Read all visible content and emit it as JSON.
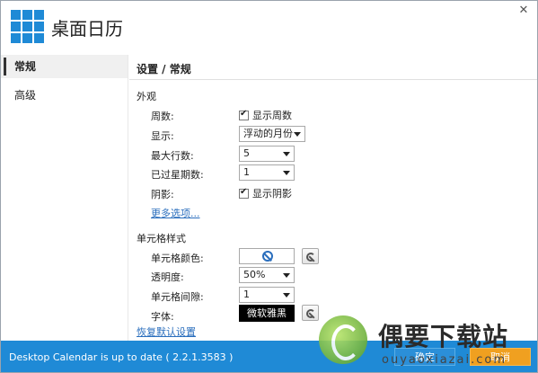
{
  "app": {
    "title": "桌面日历"
  },
  "sidebar": {
    "items": [
      {
        "label": "常规",
        "active": true
      },
      {
        "label": "高级",
        "active": false
      }
    ]
  },
  "content": {
    "title": "设置 / 常规",
    "appearance": {
      "section_label": "外观",
      "week_number": {
        "label": "周数:",
        "checkbox_label": "显示周数",
        "checked": true
      },
      "display": {
        "label": "显示:",
        "value": "浮动的月份"
      },
      "max_rows": {
        "label": "最大行数:",
        "value": "5"
      },
      "past_weeks": {
        "label": "已过星期数:",
        "value": "1"
      },
      "shadow": {
        "label": "阴影:",
        "checkbox_label": "显示阴影",
        "checked": true
      },
      "more_options": "更多选项..."
    },
    "cell_style": {
      "section_label": "单元格样式",
      "cell_color": {
        "label": "单元格颜色:"
      },
      "opacity": {
        "label": "透明度:",
        "value": "50%"
      },
      "cell_spacing": {
        "label": "单元格间隙:",
        "value": "1"
      },
      "font": {
        "label": "字体:",
        "value": "微软雅黑"
      },
      "restore_defaults": "恢复默认设置"
    }
  },
  "footer": {
    "status": "Desktop Calendar is up to date ( 2.2.1.3583 )",
    "ok_label": "确定",
    "cancel_label": "取消"
  },
  "watermark": {
    "title": "偶要下载站",
    "subtitle": "ouyaoxiazai.com"
  },
  "colors": {
    "accent": "#1f8ad6",
    "link": "#2a6ebd",
    "cancel": "#f0a020"
  }
}
